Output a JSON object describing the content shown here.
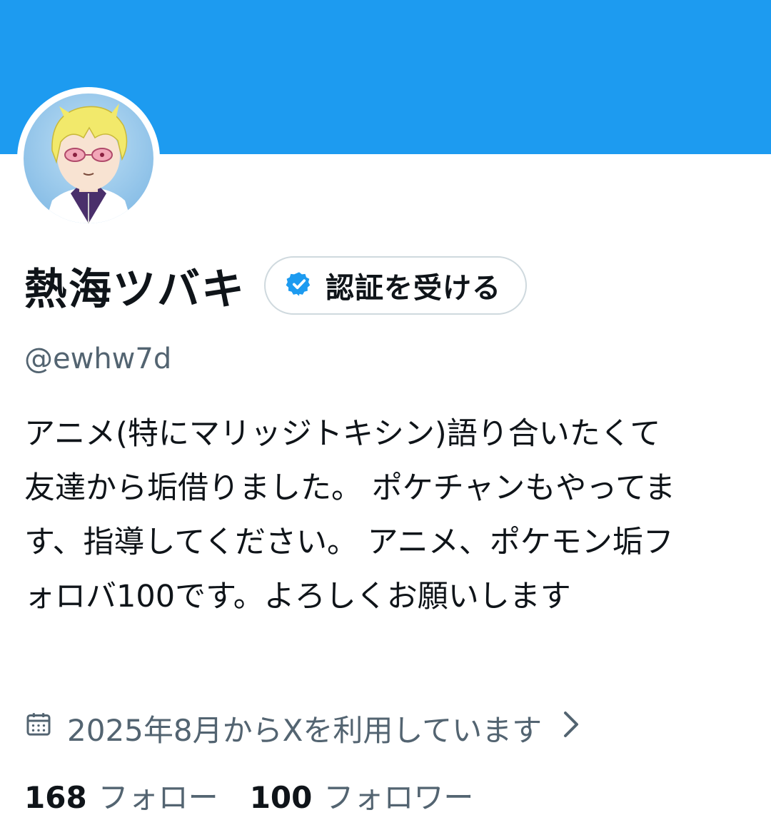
{
  "profile": {
    "display_name": "熱海ツバキ",
    "verify_button_label": "認証を受ける",
    "handle": "@ewhw7d",
    "bio_lines": [
      "アニメ(特にマリッジトキシン)語り合いたくて",
      "友達から垢借りました。 ポケチャンもやってま",
      "す、指導してください。 アニメ、ポケモン垢フ",
      "ォロバ100です。よろしくお願いします"
    ],
    "joined_text": "2025年8月からXを利用しています",
    "following_count": "168",
    "following_label": "フォロー",
    "followers_count": "100",
    "followers_label": "フォロワー"
  },
  "icons": {
    "verified": "verified-badge-icon",
    "calendar": "calendar-icon",
    "chevron": "chevron-right-icon"
  },
  "colors": {
    "banner": "#1d9bf0",
    "verified": "#1d9bf0",
    "secondary_text": "#536471",
    "primary_text": "#0f1419"
  }
}
